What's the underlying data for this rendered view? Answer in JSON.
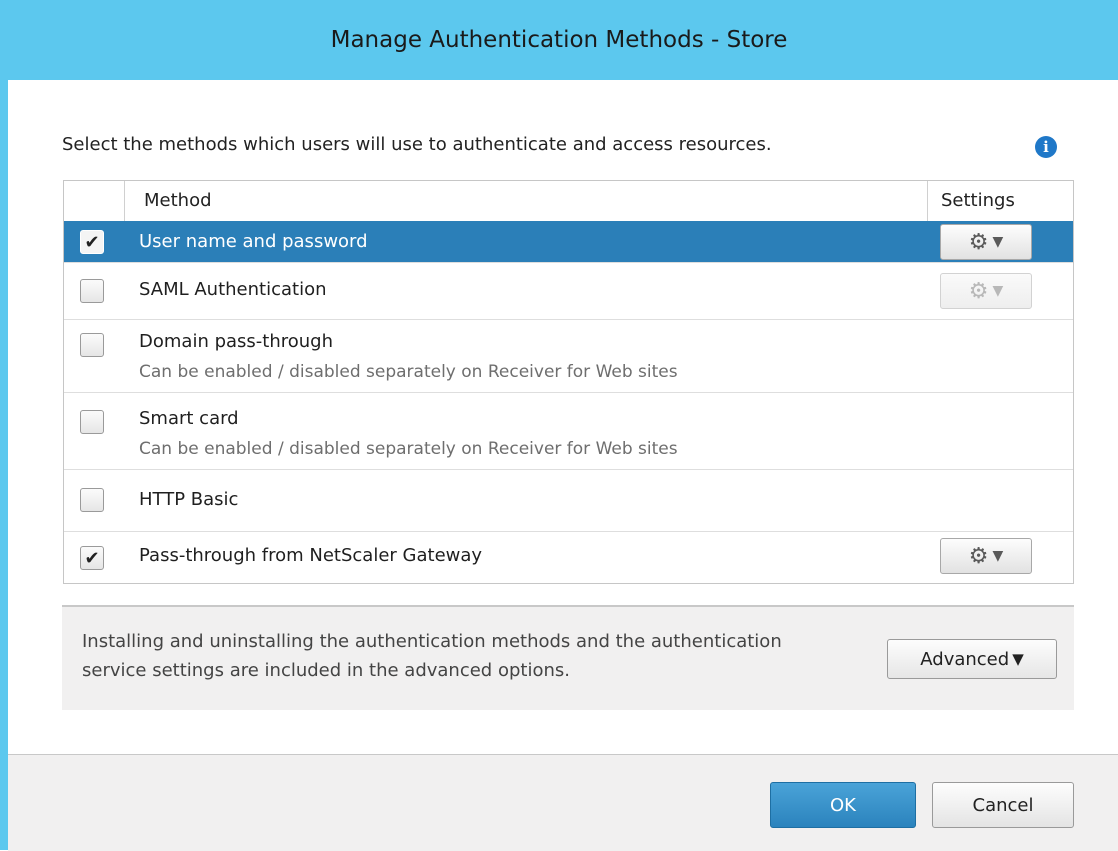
{
  "dialog": {
    "title": "Manage Authentication Methods - Store",
    "instruction": "Select the methods which users will use to authenticate and access resources.",
    "info_icon": "info-icon"
  },
  "table": {
    "headers": {
      "method": "Method",
      "settings": "Settings"
    },
    "rows": [
      {
        "label": "User name and password",
        "description": "",
        "checked": true,
        "selected": true,
        "settings": "enabled"
      },
      {
        "label": "SAML Authentication",
        "description": "",
        "checked": false,
        "selected": false,
        "settings": "disabled"
      },
      {
        "label": "Domain pass-through",
        "description": "Can be enabled / disabled separately on Receiver for Web sites",
        "checked": false,
        "selected": false,
        "settings": "none"
      },
      {
        "label": "Smart card",
        "description": "Can be enabled / disabled separately on Receiver for Web sites",
        "checked": false,
        "selected": false,
        "settings": "none"
      },
      {
        "label": "HTTP Basic",
        "description": "",
        "checked": false,
        "selected": false,
        "settings": "none"
      },
      {
        "label": "Pass-through from NetScaler Gateway",
        "description": "",
        "checked": true,
        "selected": false,
        "settings": "enabled"
      }
    ]
  },
  "advanced": {
    "text": "Installing and uninstalling the authentication methods and the authentication service settings are included in the advanced options.",
    "button_label": "Advanced"
  },
  "footer": {
    "ok_label": "OK",
    "cancel_label": "Cancel"
  },
  "colors": {
    "titlebar": "#5cc8ee",
    "selected_row": "#2b7fb8",
    "primary_button": "#2b83bd"
  }
}
